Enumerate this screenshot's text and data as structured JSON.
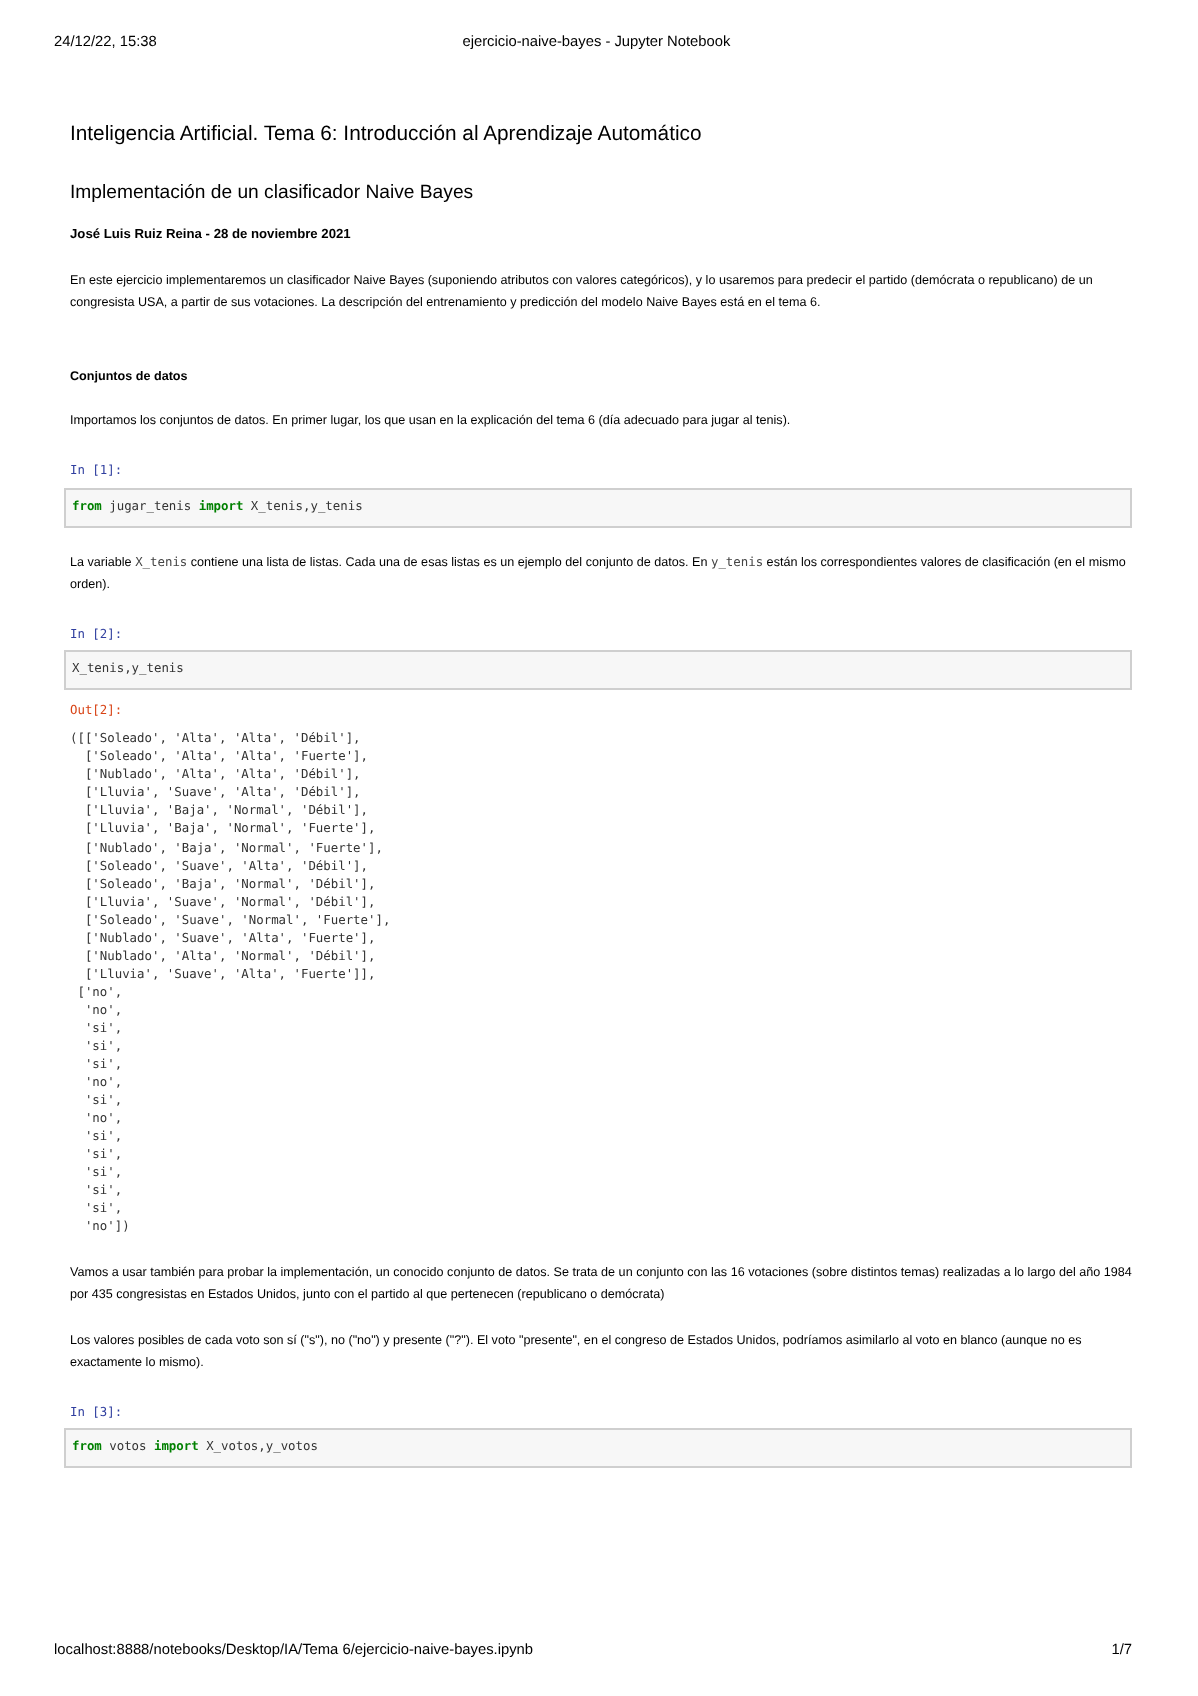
{
  "print_header": {
    "date": "24/12/22, 15:38",
    "title": "ejercicio-naive-bayes - Jupyter Notebook"
  },
  "cells": [
    {
      "kind": "heading",
      "text": "Inteligencia Artificial. Tema 6: Introducción al Aprendizaje Automático"
    },
    {
      "kind": "subheading",
      "text": "Implementación de un clasificador Naive Bayes"
    },
    {
      "kind": "author",
      "text": "José Luis Ruiz Reina - 28 de noviembre 2021"
    },
    {
      "kind": "paragraph",
      "parts": [
        {
          "kind": "text",
          "text": "En este ejercicio implementaremos un clasificador Naive Bayes (suponiendo atributos con valores categóricos), y lo usaremos para predecir el partido (demócrata o republicano) de un congresista USA, a partir de sus votaciones. La descripción del entrenamiento y predicción del modelo Naive Bayes está en el tema 6."
        }
      ]
    },
    {
      "kind": "section",
      "text": "Conjuntos de datos"
    },
    {
      "kind": "paragraph",
      "parts": [
        {
          "kind": "text",
          "text": "Importamos los conjuntos de datos. En primer lugar, los que usan en la explicación del tema 6 (día adecuado para jugar al tenis)."
        }
      ]
    },
    {
      "kind": "code",
      "prompt": "In [1]:",
      "tokens": [
        {
          "kind": "keyword",
          "text": "from"
        },
        {
          "kind": "plain",
          "text": " jugar_tenis "
        },
        {
          "kind": "keyword",
          "text": "import"
        },
        {
          "kind": "plain",
          "text": " X_tenis,y_tenis"
        }
      ]
    },
    {
      "kind": "paragraph",
      "parts": [
        {
          "kind": "text",
          "text": "La variable "
        },
        {
          "kind": "code",
          "text": "X_tenis"
        },
        {
          "kind": "text",
          "text": " contiene una lista de listas. Cada una de esas listas es un ejemplo del conjunto de datos. En "
        },
        {
          "kind": "code",
          "text": "y_tenis"
        },
        {
          "kind": "text",
          "text": " están los correspondientes valores de clasificación (en el mismo orden)."
        }
      ]
    },
    {
      "kind": "code",
      "prompt": "In [2]:",
      "tokens": [
        {
          "kind": "plain",
          "text": "X_tenis,y_tenis"
        }
      ]
    },
    {
      "kind": "output",
      "prompt": "Out[2]:",
      "lines": [
        "([['Soleado', 'Alta', 'Alta', 'Débil'],",
        "  ['Soleado', 'Alta', 'Alta', 'Fuerte'],",
        "  ['Nublado', 'Alta', 'Alta', 'Débil'],",
        "  ['Lluvia', 'Suave', 'Alta', 'Débil'],",
        "  ['Lluvia', 'Baja', 'Normal', 'Débil'],",
        "  ['Lluvia', 'Baja', 'Normal', 'Fuerte'],",
        "  ['Nublado', 'Baja', 'Normal', 'Fuerte'],",
        "  ['Soleado', 'Suave', 'Alta', 'Débil'],",
        "  ['Soleado', 'Baja', 'Normal', 'Débil'],",
        "  ['Lluvia', 'Suave', 'Normal', 'Débil'],",
        "  ['Soleado', 'Suave', 'Normal', 'Fuerte'],",
        "  ['Nublado', 'Suave', 'Alta', 'Fuerte'],",
        "  ['Nublado', 'Alta', 'Normal', 'Débil'],",
        "  ['Lluvia', 'Suave', 'Alta', 'Fuerte']],",
        " ['no',",
        "  'no',",
        "  'si',",
        "  'si',",
        "  'si',",
        "  'no',",
        "  'si',",
        "  'no',",
        "  'si',",
        "  'si',",
        "  'si',",
        "  'si',",
        "  'si',",
        "  'no'])"
      ]
    },
    {
      "kind": "paragraph",
      "parts": [
        {
          "kind": "text",
          "text": "Vamos a usar también para probar la implementación, un conocido conjunto de datos. Se trata de un conjunto con las 16 votaciones (sobre distintos temas) realizadas a lo largo del año 1984 por 435 congresistas en Estados Unidos, junto con el partido al que pertenecen (republicano o demócrata)"
        }
      ]
    },
    {
      "kind": "paragraph",
      "parts": [
        {
          "kind": "text",
          "text": "Los valores posibles de cada voto son sí (\"s\"), no (\"no\") y presente (\"?\"). El voto \"presente\", en el congreso de Estados Unidos, podríamos asimilarlo al voto en blanco (aunque no es exactamente lo mismo)."
        }
      ]
    },
    {
      "kind": "code",
      "prompt": "In [3]:",
      "tokens": [
        {
          "kind": "keyword",
          "text": "from"
        },
        {
          "kind": "plain",
          "text": " votos "
        },
        {
          "kind": "keyword",
          "text": "import"
        },
        {
          "kind": "plain",
          "text": " X_votos,y_votos"
        }
      ]
    }
  ],
  "print_footer": {
    "url": "localhost:8888/notebooks/Desktop/IA/Tema 6/ejercicio-naive-bayes.ipynb",
    "page": "1/7"
  }
}
